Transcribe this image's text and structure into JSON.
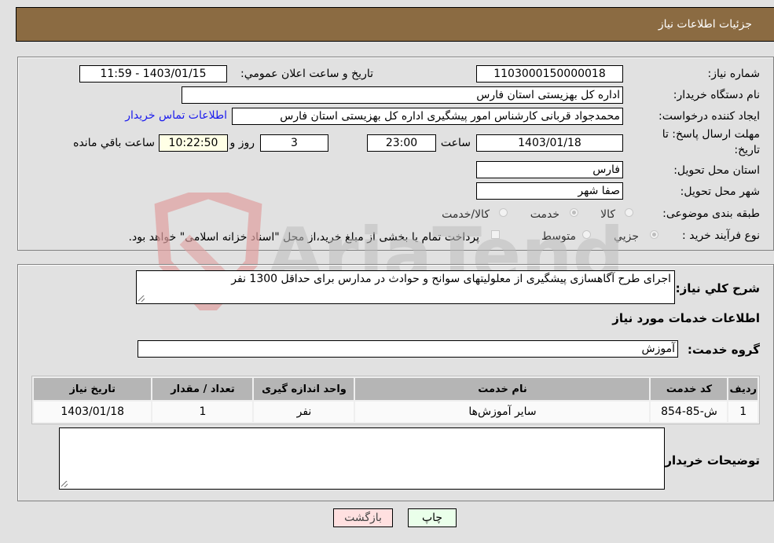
{
  "header": {
    "title": "جزئیات اطلاعات نیاز"
  },
  "details": {
    "need_number_label": "شماره نیاز:",
    "need_number": "1103000150000018",
    "announce_label": "تاریخ و ساعت اعلان عمومي:",
    "announce_value": "1403/01/15 - 11:59",
    "buyer_org_label": "نام دستگاه خریدار:",
    "buyer_org": "اداره کل بهزیستی استان فارس",
    "creator_label": "ایجاد کننده درخواست:",
    "creator": "محمدجواد قربانی کارشناس امور پیشگیری اداره کل بهزیستی استان فارس",
    "contact_link": "اطلاعات تماس خریدار",
    "deadline_label_line1": "مهلت ارسال پاسخ: تا",
    "deadline_label_line2": "تاریخ:",
    "deadline_date": "1403/01/18",
    "time_label": "ساعت",
    "deadline_time": "23:00",
    "days_value": "3",
    "days_label": "روز و",
    "remaining_time": "10:22:50",
    "remaining_label": "ساعت باقي مانده",
    "province_label": "استان محل تحویل:",
    "province": "فارس",
    "city_label": "شهر محل تحویل:",
    "city": "صفا شهر",
    "category_label": "طبقه بندی موضوعی:",
    "category_options": [
      {
        "label": "کالا",
        "selected": false
      },
      {
        "label": "خدمت",
        "selected": true
      },
      {
        "label": "کالا/خدمت",
        "selected": false
      }
    ],
    "process_label": "نوع فرآیند خرید :",
    "process_options": [
      {
        "label": "جزيي",
        "selected": true
      },
      {
        "label": "متوسط",
        "selected": false
      }
    ],
    "payment_note": "پرداخت تمام یا بخشی از مبلغ خرید،از محل \"اسناد خزانه اسلامی\" خواهد بود."
  },
  "services": {
    "description_label": "شرح کلي نياز:",
    "description": "اجرای طرح آگاهسازی پیشگیری از معلولیتهای سوانح و حوادث در مدارس برای حداقل 1300 نفر",
    "section_title": "اطلاعات خدمات مورد نياز",
    "group_label": "گروه خدمت:",
    "group_value": "آموزش",
    "table": {
      "columns": [
        "ردیف",
        "کد خدمت",
        "نام خدمت",
        "واحد اندازه گیری",
        "تعداد / مقدار",
        "تاریخ نیاز"
      ],
      "rows": [
        [
          "1",
          "ش-85-854",
          "سایر آموزش‌ها",
          "نفر",
          "1",
          "1403/01/18"
        ]
      ]
    },
    "buyer_notes_label": "توضیحات خریدار:",
    "buyer_notes": ""
  },
  "buttons": {
    "print": "چاپ",
    "back": "بازگشت"
  },
  "watermark": {
    "text": "AriaTender.neT"
  },
  "colors": {
    "header_bg": "#8b6b42",
    "link": "#1a1aee",
    "print_bg": "#eaffea",
    "back_bg": "#ffe0e0"
  }
}
